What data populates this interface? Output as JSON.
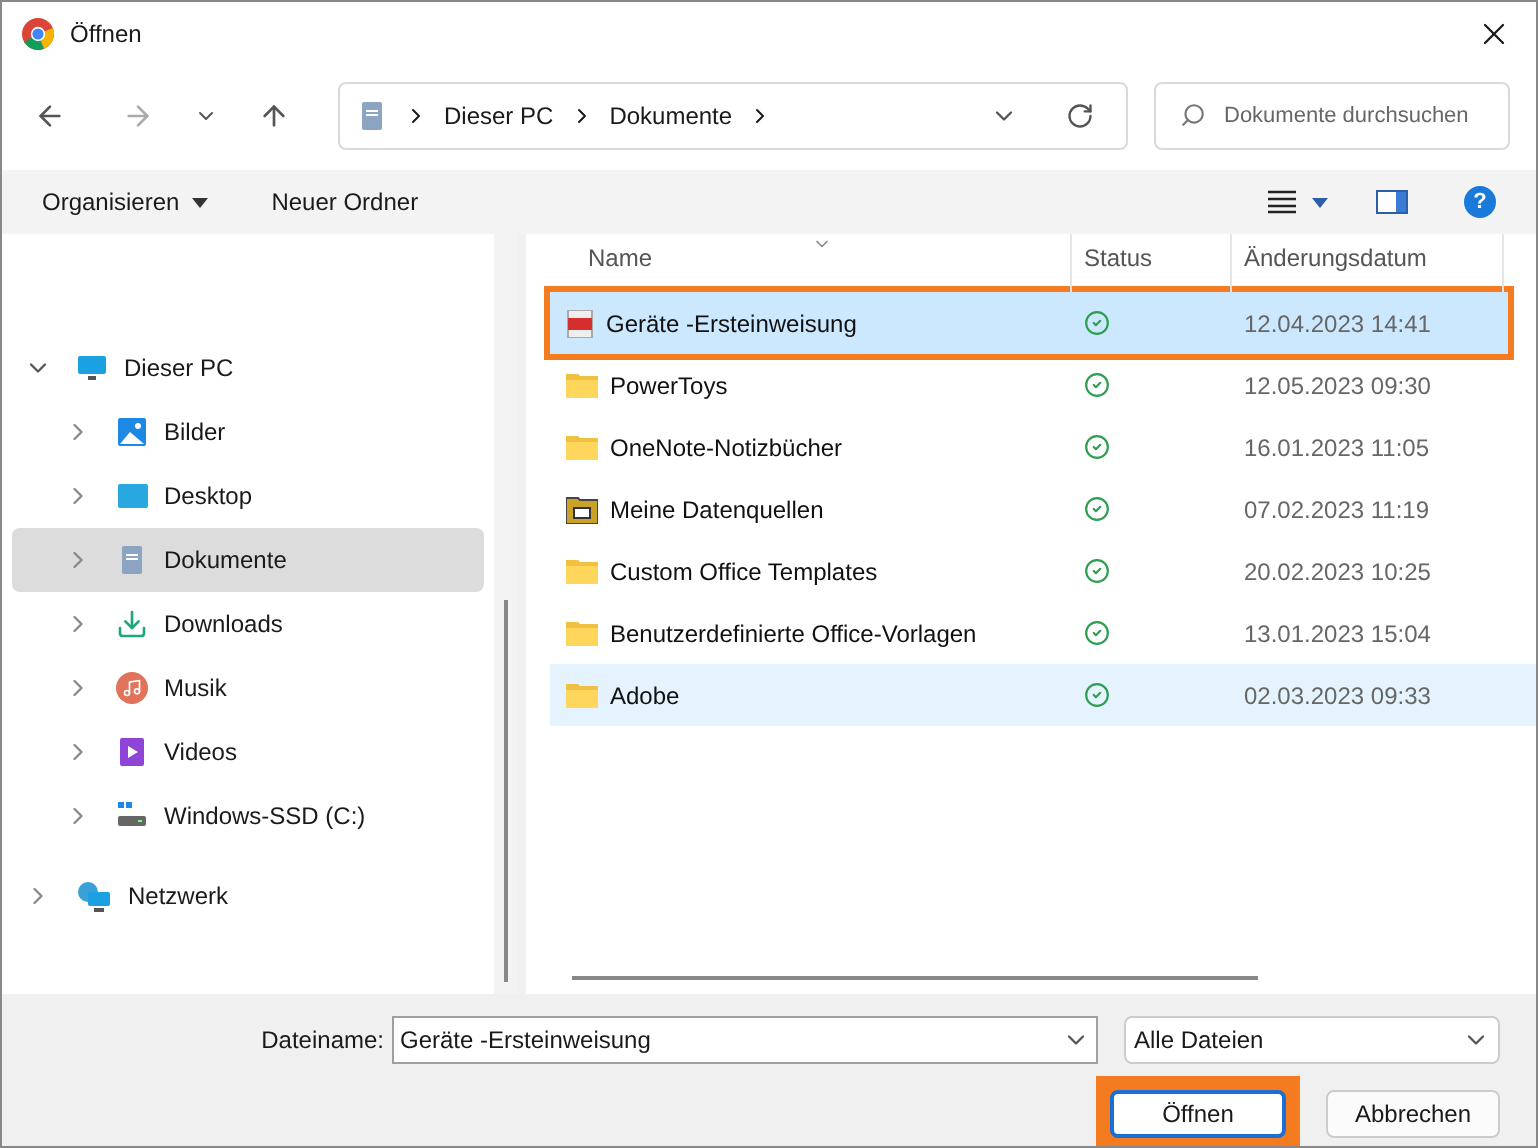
{
  "window": {
    "title": "Öffnen"
  },
  "address_bar": {
    "segments": [
      "Dieser PC",
      "Dokumente"
    ]
  },
  "search": {
    "placeholder": "Dokumente durchsuchen"
  },
  "toolbar": {
    "organize": "Organisieren",
    "new_folder": "Neuer Ordner",
    "help": "?"
  },
  "sidebar": {
    "items": [
      {
        "label": "Dieser PC",
        "kind": "pc",
        "expanded": true,
        "selected": false,
        "children": [
          {
            "label": "Bilder",
            "kind": "pictures",
            "expanded": false,
            "selected": false
          },
          {
            "label": "Desktop",
            "kind": "desktop",
            "expanded": false,
            "selected": false
          },
          {
            "label": "Dokumente",
            "kind": "documents",
            "expanded": false,
            "selected": true
          },
          {
            "label": "Downloads",
            "kind": "downloads",
            "expanded": false,
            "selected": false
          },
          {
            "label": "Musik",
            "kind": "music",
            "expanded": false,
            "selected": false
          },
          {
            "label": "Videos",
            "kind": "videos",
            "expanded": false,
            "selected": false
          },
          {
            "label": "Windows-SSD (C:)",
            "kind": "drive",
            "expanded": false,
            "selected": false
          }
        ]
      },
      {
        "label": "Netzwerk",
        "kind": "network",
        "expanded": false,
        "selected": false
      }
    ]
  },
  "table": {
    "columns": [
      "Name",
      "Status",
      "Änderungsdatum"
    ],
    "rows": [
      {
        "name": "Geräte -Ersteinweisung",
        "kind": "pdf",
        "date": "12.04.2023 14:41",
        "selected": true,
        "hovered": false,
        "highlighted": true
      },
      {
        "name": "PowerToys",
        "kind": "folder",
        "date": "12.05.2023 09:30",
        "selected": false,
        "hovered": false,
        "highlighted": false
      },
      {
        "name": "OneNote-Notizbücher",
        "kind": "folder",
        "date": "16.01.2023 11:05",
        "selected": false,
        "hovered": false,
        "highlighted": false
      },
      {
        "name": "Meine Datenquellen",
        "kind": "datafolder",
        "date": "07.02.2023 11:19",
        "selected": false,
        "hovered": false,
        "highlighted": false
      },
      {
        "name": "Custom Office Templates",
        "kind": "folder",
        "date": "20.02.2023 10:25",
        "selected": false,
        "hovered": false,
        "highlighted": false
      },
      {
        "name": "Benutzerdefinierte Office-Vorlagen",
        "kind": "folder",
        "date": "13.01.2023 15:04",
        "selected": false,
        "hovered": false,
        "highlighted": false
      },
      {
        "name": "Adobe",
        "kind": "folder",
        "date": "02.03.2023 09:33",
        "selected": false,
        "hovered": true,
        "highlighted": false
      }
    ]
  },
  "footer": {
    "filename_label": "Dateiname:",
    "filename": "Geräte -Ersteinweisung",
    "filetype": "Alle Dateien",
    "open_button": {
      "label": "Öffnen",
      "highlighted": true
    },
    "cancel_button": "Abbrechen"
  }
}
